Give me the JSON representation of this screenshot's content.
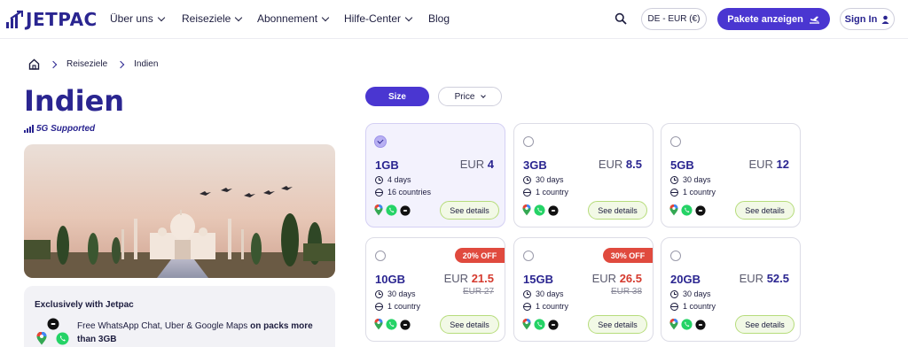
{
  "nav": {
    "logo": "JETPAC",
    "items": [
      {
        "label": "Über uns",
        "has_menu": true
      },
      {
        "label": "Reiseziele",
        "has_menu": true
      },
      {
        "label": "Abonnement",
        "has_menu": true
      },
      {
        "label": "Hilfe-Center",
        "has_menu": true
      },
      {
        "label": "Blog",
        "has_menu": false
      }
    ],
    "currency": "DE - EUR (€)",
    "packages_button": "Pakete anzeigen",
    "signin": "Sign In"
  },
  "breadcrumb": {
    "items": [
      "Reiseziele",
      "Indien"
    ]
  },
  "page": {
    "title": "Indien",
    "network_badge": "5G Supported"
  },
  "exclusive": {
    "title": "Exclusively with Jetpac",
    "text_plain": "Free WhatsApp Chat, Uber & Google Maps ",
    "text_bold": "on packs more than 3GB"
  },
  "filters": {
    "size": "Size",
    "price": "Price"
  },
  "cards": [
    {
      "data": "1GB",
      "currency": "EUR",
      "price": "4",
      "old_price": "",
      "discount": "",
      "duration": "4 days",
      "coverage": "16 countries",
      "selected": true,
      "details": "See details"
    },
    {
      "data": "3GB",
      "currency": "EUR",
      "price": "8.5",
      "old_price": "",
      "discount": "",
      "duration": "30 days",
      "coverage": "1 country",
      "selected": false,
      "details": "See details"
    },
    {
      "data": "5GB",
      "currency": "EUR",
      "price": "12",
      "old_price": "",
      "discount": "",
      "duration": "30 days",
      "coverage": "1 country",
      "selected": false,
      "details": "See details"
    },
    {
      "data": "10GB",
      "currency": "EUR",
      "price": "21.5",
      "old_price": "EUR 27",
      "discount": "20% OFF",
      "duration": "30 days",
      "coverage": "1 country",
      "selected": false,
      "details": "See details"
    },
    {
      "data": "15GB",
      "currency": "EUR",
      "price": "26.5",
      "old_price": "EUR 38",
      "discount": "30% OFF",
      "duration": "30 days",
      "coverage": "1 country",
      "selected": false,
      "details": "See details"
    },
    {
      "data": "20GB",
      "currency": "EUR",
      "price": "52.5",
      "old_price": "",
      "discount": "",
      "duration": "30 days",
      "coverage": "1 country",
      "selected": false,
      "details": "See details"
    }
  ],
  "colors": {
    "brand": "#2a2590",
    "accent": "#4a36d1",
    "sale": "#e04a3e",
    "details_border": "#b6dc7b"
  },
  "icons": {
    "logo": "bars-logo-icon",
    "search": "search-icon",
    "plane": "plane-icon",
    "user": "user-icon",
    "home": "home-icon",
    "clock": "clock-icon",
    "globe": "globe-icon",
    "maps": "google-maps-icon",
    "whatsapp": "whatsapp-icon",
    "uber": "uber-icon"
  }
}
